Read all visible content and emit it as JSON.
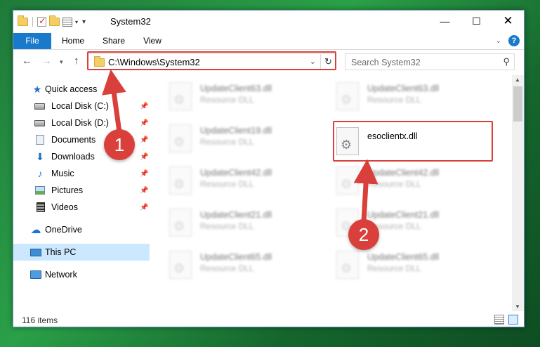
{
  "window": {
    "title": "System32"
  },
  "ribbon": {
    "tabs": [
      {
        "label": "File"
      },
      {
        "label": "Home"
      },
      {
        "label": "Share"
      },
      {
        "label": "View"
      }
    ]
  },
  "navigation": {
    "address": "C:\\Windows\\System32",
    "search_placeholder": "Search System32"
  },
  "sidebar": {
    "items": [
      {
        "label": "Quick access",
        "icon": "star-icon",
        "pinned": false
      },
      {
        "label": "Local Disk (C:)",
        "icon": "disk-icon",
        "pinned": true
      },
      {
        "label": "Local Disk (D:)",
        "icon": "disk-icon",
        "pinned": true
      },
      {
        "label": "Documents",
        "icon": "documents-icon",
        "pinned": true
      },
      {
        "label": "Downloads",
        "icon": "downloads-icon",
        "pinned": true
      },
      {
        "label": "Music",
        "icon": "music-icon",
        "pinned": true
      },
      {
        "label": "Pictures",
        "icon": "pictures-icon",
        "pinned": true
      },
      {
        "label": "Videos",
        "icon": "videos-icon",
        "pinned": true
      },
      {
        "label": "OneDrive",
        "icon": "onedrive-icon",
        "pinned": false
      },
      {
        "label": "This PC",
        "icon": "this-pc-icon",
        "pinned": false,
        "selected": true
      },
      {
        "label": "Network",
        "icon": "network-icon",
        "pinned": false
      }
    ]
  },
  "files": {
    "left_column": [
      {
        "name": "UpdateClient63.dll",
        "type": "Resource DLL"
      },
      {
        "name": "UpdateClient19.dll",
        "type": "Resource DLL"
      },
      {
        "name": "UpdateClient42.dll",
        "type": "Resource DLL"
      },
      {
        "name": "UpdateClient21.dll",
        "type": "Resource DLL"
      },
      {
        "name": "UpdateClient65.dll",
        "type": "Resource DLL"
      }
    ],
    "right_column": [
      {
        "name": "UpdateClient63.dll",
        "type": "Resource DLL"
      },
      {
        "name": "esoclientx.dll",
        "type": ""
      },
      {
        "name": "UpdateClient42.dll",
        "type": "Resource DLL"
      },
      {
        "name": "UpdateClient21.dll",
        "type": "Resource DLL"
      },
      {
        "name": "UpdateClient65.dll",
        "type": "Resource DLL"
      }
    ]
  },
  "status": {
    "item_count": "116 items"
  },
  "annotations": {
    "step_1": "1",
    "step_2": "2",
    "color": "#d9403b"
  },
  "colors": {
    "accent": "#1979ca",
    "selection": "#cce8ff"
  }
}
